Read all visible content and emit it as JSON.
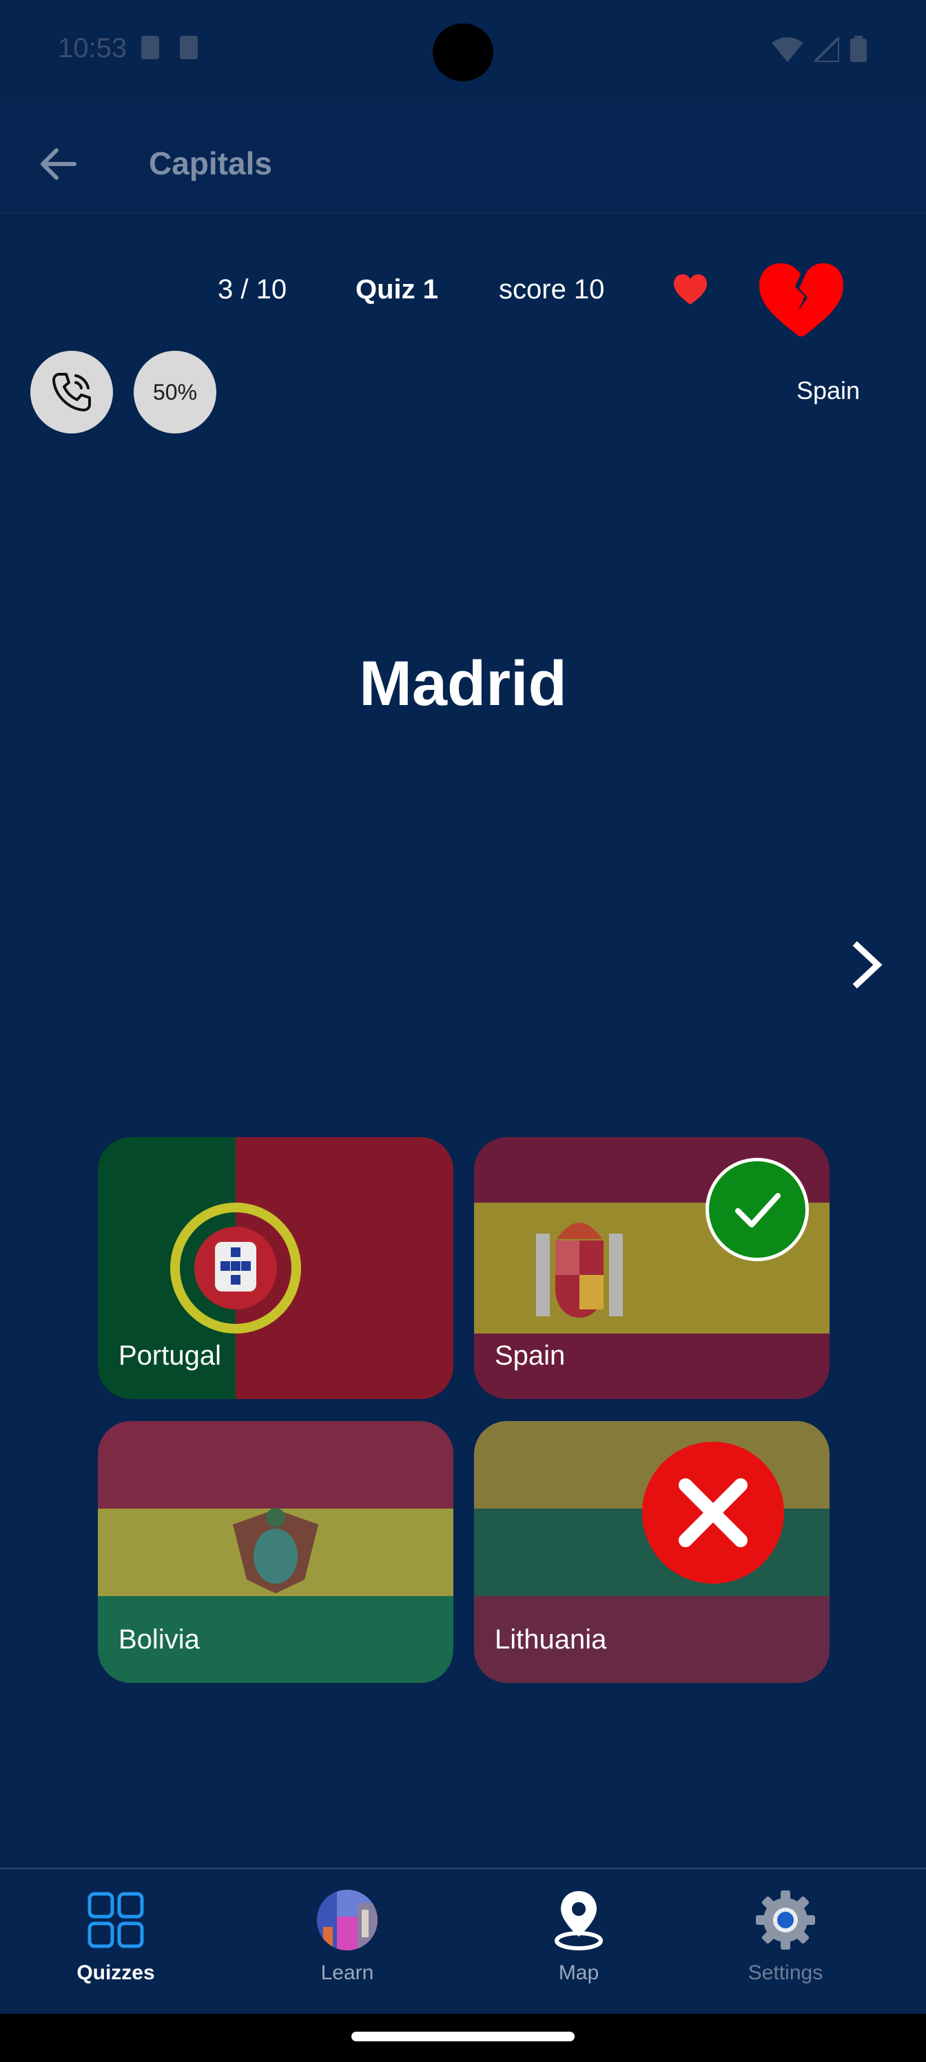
{
  "status_bar": {
    "time": "10:53"
  },
  "app_bar": {
    "title": "Capitals"
  },
  "quiz": {
    "progress": "3 / 10",
    "quiz_name": "Quiz 1",
    "score": "score 10",
    "hint_country": "Spain",
    "fifty_fifty_label": "50%",
    "question": "Madrid"
  },
  "answers": [
    {
      "label": "Portugal",
      "state": "neutral"
    },
    {
      "label": "Spain",
      "state": "correct"
    },
    {
      "label": "Bolivia",
      "state": "neutral"
    },
    {
      "label": "Lithuania",
      "state": "wrong"
    }
  ],
  "bottom_nav": {
    "items": [
      {
        "label": "Quizzes",
        "icon": "grid-icon",
        "selected": true
      },
      {
        "label": "Learn",
        "icon": "globe-photo-icon",
        "selected": false
      },
      {
        "label": "Map",
        "icon": "map-pin-icon",
        "selected": false
      },
      {
        "label": "Settings",
        "icon": "gear-icon",
        "selected": false
      }
    ]
  },
  "colors": {
    "background": "#05244f",
    "correct": "#0a8a17",
    "wrong": "#e61010",
    "heart": "#ff0000",
    "nav_selected": "#2196f3"
  }
}
